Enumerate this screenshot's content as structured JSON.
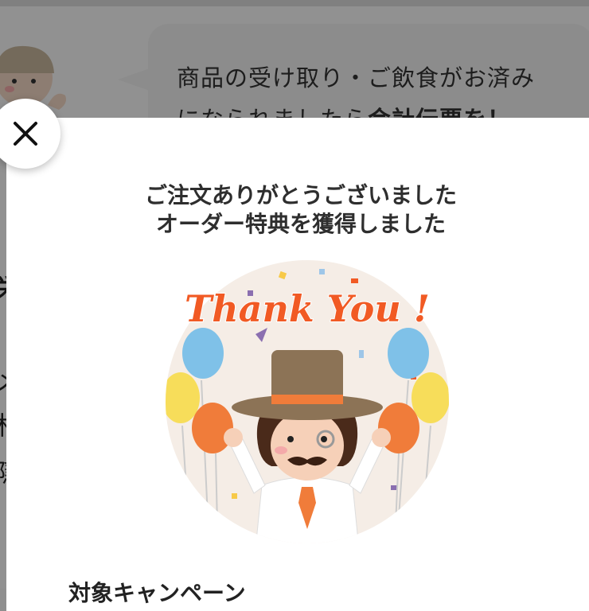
{
  "background": {
    "message_line1": "商品の受け取り・ご飲食がお済み",
    "message_line2_regular": "になられましたら",
    "message_line2_bold": "会計伝票を！",
    "left_chars": [
      "栄",
      "メ",
      "札",
      "隠"
    ]
  },
  "modal": {
    "title_line1": "ご注文ありがとうございました",
    "title_line2": "オーダー特典を獲得しました",
    "illustration_text": "Thank You !",
    "campaign_label": "対象キャンペーン",
    "close_icon": "close-icon"
  },
  "colors": {
    "accent_orange": "#f15a24",
    "overlay": "rgba(0,0,0,0.42)"
  }
}
